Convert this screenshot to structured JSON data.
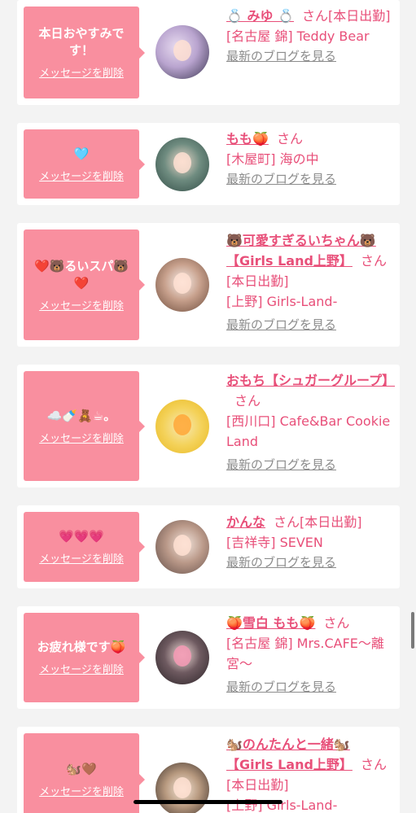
{
  "delete_label": "メッセージを削除",
  "blog_label": "最新のブログを見る",
  "san_label": "さん",
  "colors": {
    "accent": "#f98f9f",
    "name": "#e84f79",
    "link_gray": "#8c8c8c",
    "bg": "#f3f3f3"
  },
  "cards": [
    {
      "message": "本日おやすみです！",
      "name": "💍 みゆ 💍",
      "suffix": "[本日出勤]",
      "store": "[名古屋 錦] Teddy Bear",
      "avatar_colors": [
        "#e8dcf0",
        "#3a3550"
      ]
    },
    {
      "message": "🩵",
      "name": "もも🍑",
      "suffix": "",
      "store": "[木屋町] 海の中",
      "avatar_colors": [
        "#2f4a44",
        "#9fb8a8"
      ]
    },
    {
      "message": "❤️🐻るいスパ🐻❤️",
      "name": "🐻可愛すぎるいちゃん🐻【Girls Land上野】",
      "suffix": "[本日出勤]",
      "store": "[上野] Girls-Land-",
      "avatar_colors": [
        "#f1e6e2",
        "#6b4a3a"
      ]
    },
    {
      "message": "☁️🍼🧸☕。",
      "name": "おもち【シュガーグループ】",
      "suffix": "",
      "store": "[西川口] Cafe&Bar Cookie Land",
      "avatar_colors": [
        "#f6e7b0",
        "#f0c930"
      ]
    },
    {
      "message": "💗💗💗",
      "name": "かんな",
      "suffix": "[本日出勤]",
      "store": "[吉祥寺] SEVEN",
      "avatar_colors": [
        "#d9c5bc",
        "#5e4a45"
      ]
    },
    {
      "message": "お疲れ様です🍑",
      "name": "🍑雪白 もも🍑",
      "suffix": "",
      "store": "[名古屋 錦] Mrs.CAFE〜離宮〜",
      "avatar_colors": [
        "#2a2226",
        "#f29ab4"
      ]
    },
    {
      "message": "🐿️🤎",
      "name": "🐿️のんたんと一緒🐿️【Girls Land上野】",
      "suffix": "[本日出勤]",
      "store": "[上野] Girls-Land-",
      "avatar_colors": [
        "#d8c0a8",
        "#3a2e28"
      ]
    }
  ]
}
